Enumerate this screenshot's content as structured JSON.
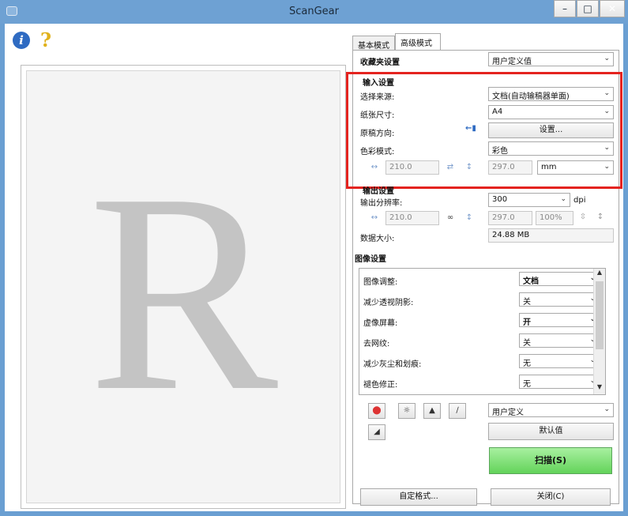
{
  "window": {
    "title": "ScanGear"
  },
  "toolbar": {
    "info_glyph": "i",
    "help_glyph": "?"
  },
  "preview": {
    "letter": "R"
  },
  "tabs": [
    {
      "label": "基本模式"
    },
    {
      "label": "高级模式"
    }
  ],
  "favorites": {
    "label": "收藏夹设置",
    "value": "用户定义值"
  },
  "input_settings": {
    "title": "输入设置",
    "select_source_label": "选择来源:",
    "select_source_value": "文档(自动输稿器单面)",
    "paper_size_label": "纸张尺寸:",
    "paper_size_value": "A4",
    "orientation_label": "原稿方向:",
    "orientation_button": "设置...",
    "color_mode_label": "色彩模式:",
    "color_mode_value": "彩色",
    "width": "210.0",
    "height": "297.0",
    "unit": "mm"
  },
  "output_settings": {
    "title": "输出设置",
    "resolution_label": "输出分辨率:",
    "resolution_value": "300",
    "resolution_unit": "dpi",
    "width": "210.0",
    "height": "297.0",
    "scale": "100%",
    "data_size_label": "数据大小:",
    "data_size_value": "24.88 MB"
  },
  "image_settings": {
    "title": "图像设置",
    "rows": [
      {
        "label": "图像调整:",
        "value": "文档",
        "bold": true
      },
      {
        "label": "减少透视阴影:",
        "value": "关",
        "bold": false
      },
      {
        "label": "虚像屏幕:",
        "value": "开",
        "bold": true
      },
      {
        "label": "去网纹:",
        "value": "关",
        "bold": false
      },
      {
        "label": "减少灰尘和划痕:",
        "value": "无",
        "bold": false
      },
      {
        "label": "褪色修正:",
        "value": "无",
        "bold": false
      }
    ]
  },
  "tools": {
    "custom_value": "用户定义",
    "defaults_button": "默认值"
  },
  "actions": {
    "scan_button": "扫描(S)",
    "preferences_button": "自定格式...",
    "close_button": "关闭(C)"
  }
}
